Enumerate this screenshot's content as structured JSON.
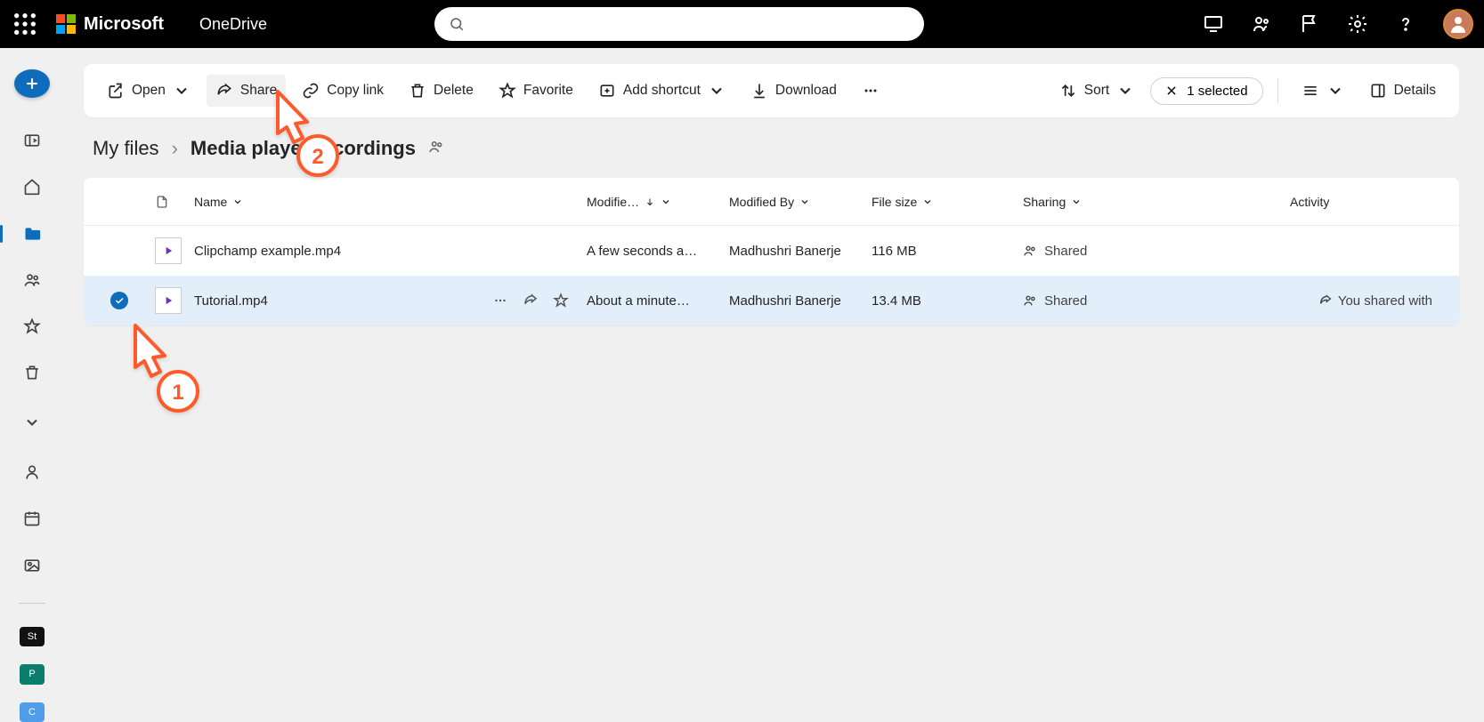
{
  "header": {
    "brand": "Microsoft",
    "app": "OneDrive",
    "search_placeholder": ""
  },
  "toolbar": {
    "open": "Open",
    "share": "Share",
    "copy_link": "Copy link",
    "delete": "Delete",
    "favorite": "Favorite",
    "add_shortcut": "Add shortcut",
    "download": "Download",
    "sort": "Sort",
    "selected": "1 selected",
    "details": "Details"
  },
  "breadcrumb": {
    "root": "My files",
    "current": "Media player recordings"
  },
  "columns": {
    "name": "Name",
    "modified": "Modifie…",
    "modified_by": "Modified By",
    "size": "File size",
    "sharing": "Sharing",
    "activity": "Activity"
  },
  "rows": [
    {
      "name": "Clipchamp example.mp4",
      "modified": "A few seconds a…",
      "modified_by": "Madhushri Banerje",
      "size": "116 MB",
      "sharing": "Shared",
      "activity": "",
      "selected": false
    },
    {
      "name": "Tutorial.mp4",
      "modified": "About a minute…",
      "modified_by": "Madhushri Banerje",
      "size": "13.4 MB",
      "sharing": "Shared",
      "activity": "You shared with",
      "selected": true
    }
  ],
  "sidebar_tiles": {
    "a": "St",
    "b": "P",
    "c": "C"
  },
  "annotations": [
    {
      "n": "1"
    },
    {
      "n": "2"
    }
  ]
}
